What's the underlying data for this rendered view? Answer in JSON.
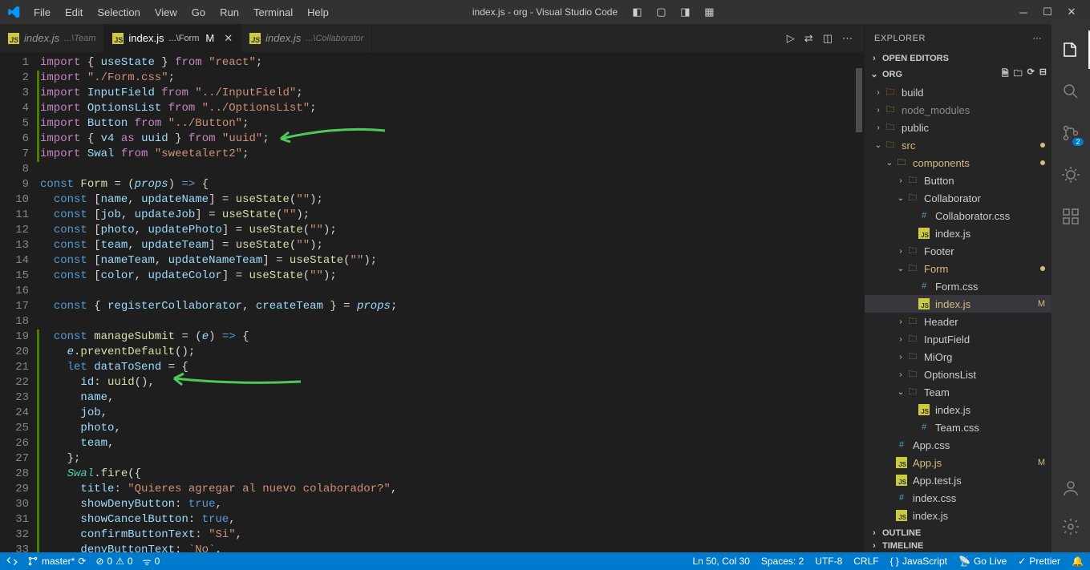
{
  "title": "index.js - org - Visual Studio Code",
  "menus": [
    "File",
    "Edit",
    "Selection",
    "View",
    "Go",
    "Run",
    "Terminal",
    "Help"
  ],
  "tabs": [
    {
      "name": "index.js",
      "path": "...\\Team",
      "active": false,
      "mod": false,
      "italic": true
    },
    {
      "name": "index.js",
      "path": "...\\Form",
      "active": true,
      "mod": true,
      "italic": false
    },
    {
      "name": "index.js",
      "path": "...\\Collaborator",
      "active": false,
      "mod": false,
      "italic": true
    }
  ],
  "sidebar": {
    "title": "EXPLORER",
    "openEditors": "OPEN EDITORS",
    "root": "ORG",
    "outline": "OUTLINE",
    "timeline": "TIMELINE"
  },
  "tree": [
    {
      "depth": 0,
      "type": "folder",
      "name": "build",
      "open": false,
      "color": "#e37933"
    },
    {
      "depth": 0,
      "type": "folder",
      "name": "node_modules",
      "open": false,
      "color": "#8dc149",
      "dim": true
    },
    {
      "depth": 0,
      "type": "folder",
      "name": "public",
      "open": false,
      "color": "#c09553"
    },
    {
      "depth": 0,
      "type": "folder",
      "name": "src",
      "open": true,
      "color": "#7fba00",
      "dot": true,
      "mod": true
    },
    {
      "depth": 1,
      "type": "folder",
      "name": "components",
      "open": true,
      "color": "#dcb67a",
      "dot": true,
      "mod": true
    },
    {
      "depth": 2,
      "type": "folder",
      "name": "Button",
      "open": false
    },
    {
      "depth": 2,
      "type": "folder",
      "name": "Collaborator",
      "open": true
    },
    {
      "depth": 3,
      "type": "css",
      "name": "Collaborator.css"
    },
    {
      "depth": 3,
      "type": "js",
      "name": "index.js"
    },
    {
      "depth": 2,
      "type": "folder",
      "name": "Footer",
      "open": false
    },
    {
      "depth": 2,
      "type": "folder",
      "name": "Form",
      "open": true,
      "dot": true,
      "mod": true
    },
    {
      "depth": 3,
      "type": "css",
      "name": "Form.css"
    },
    {
      "depth": 3,
      "type": "js",
      "name": "index.js",
      "selected": true,
      "badge": "M",
      "mod": true
    },
    {
      "depth": 2,
      "type": "folder",
      "name": "Header",
      "open": false
    },
    {
      "depth": 2,
      "type": "folder",
      "name": "InputField",
      "open": false
    },
    {
      "depth": 2,
      "type": "folder",
      "name": "MiOrg",
      "open": false
    },
    {
      "depth": 2,
      "type": "folder",
      "name": "OptionsList",
      "open": false
    },
    {
      "depth": 2,
      "type": "folder",
      "name": "Team",
      "open": true
    },
    {
      "depth": 3,
      "type": "js",
      "name": "index.js"
    },
    {
      "depth": 3,
      "type": "css",
      "name": "Team.css"
    },
    {
      "depth": 1,
      "type": "css",
      "name": "App.css"
    },
    {
      "depth": 1,
      "type": "js",
      "name": "App.js",
      "badge": "M",
      "mod": true
    },
    {
      "depth": 1,
      "type": "js",
      "name": "App.test.js"
    },
    {
      "depth": 1,
      "type": "css",
      "name": "index.css"
    },
    {
      "depth": 1,
      "type": "js",
      "name": "index.js"
    }
  ],
  "status": {
    "remote": "",
    "branch": "master*",
    "sync": "⟳",
    "errors": "0",
    "warnings": "0",
    "port": "0",
    "lncol": "Ln 50, Col 30",
    "spaces": "Spaces: 2",
    "encoding": "UTF-8",
    "eol": "CRLF",
    "lang": "JavaScript",
    "golive": "Go Live",
    "prettier": "Prettier"
  },
  "scm_badge": "2",
  "code": [
    {
      "n": 1,
      "html": "<span class='tk-k'>import</span> <span class='tk-pu'>{</span> <span class='tk-v'>useState</span> <span class='tk-pu'>}</span> <span class='tk-k'>from</span> <span class='tk-s'>\"react\"</span><span class='tk-pu'>;</span>"
    },
    {
      "n": 2,
      "html": "<span class='tk-k'>import</span> <span class='tk-s'>\"./Form.css\"</span><span class='tk-pu'>;</span>"
    },
    {
      "n": 3,
      "html": "<span class='tk-k'>import</span> <span class='tk-v'>InputField</span> <span class='tk-k'>from</span> <span class='tk-s'>\"../InputField\"</span><span class='tk-pu'>;</span>"
    },
    {
      "n": 4,
      "html": "<span class='tk-k'>import</span> <span class='tk-v'>OptionsList</span> <span class='tk-k'>from</span> <span class='tk-s'>\"../OptionsList\"</span><span class='tk-pu'>;</span>"
    },
    {
      "n": 5,
      "html": "<span class='tk-k'>import</span> <span class='tk-v'>Button</span> <span class='tk-k'>from</span> <span class='tk-s'>\"../Button\"</span><span class='tk-pu'>;</span>"
    },
    {
      "n": 6,
      "html": "<span class='tk-k'>import</span> <span class='tk-pu'>{</span> <span class='tk-v'>v4</span> <span class='tk-k'>as</span> <span class='tk-v'>uuid</span> <span class='tk-pu'>}</span> <span class='tk-k'>from</span> <span class='tk-s'>\"uuid\"</span><span class='tk-pu'>;</span>"
    },
    {
      "n": 7,
      "html": "<span class='tk-k'>import</span> <span class='tk-v'>Swal</span> <span class='tk-k'>from</span> <span class='tk-s'>\"sweetalert2\"</span><span class='tk-pu'>;</span>"
    },
    {
      "n": 8,
      "html": ""
    },
    {
      "n": 9,
      "html": "<span class='tk-p'>const</span> <span class='tk-fn'>Form</span> <span class='tk-pu'>=</span> <span class='tk-pu'>(</span><span class='tk-v tk-it'>props</span><span class='tk-pu'>)</span> <span class='tk-p'>=&gt;</span> <span class='tk-pu'>{</span>"
    },
    {
      "n": 10,
      "html": "  <span class='tk-p'>const</span> <span class='tk-pu'>[</span><span class='tk-v'>name</span><span class='tk-pu'>,</span> <span class='tk-v'>updateName</span><span class='tk-pu'>]</span> <span class='tk-pu'>=</span> <span class='tk-fn'>useState</span><span class='tk-pu'>(</span><span class='tk-s'>\"\"</span><span class='tk-pu'>);</span>"
    },
    {
      "n": 11,
      "html": "  <span class='tk-p'>const</span> <span class='tk-pu'>[</span><span class='tk-v'>job</span><span class='tk-pu'>,</span> <span class='tk-v'>updateJob</span><span class='tk-pu'>]</span> <span class='tk-pu'>=</span> <span class='tk-fn'>useState</span><span class='tk-pu'>(</span><span class='tk-s'>\"\"</span><span class='tk-pu'>);</span>"
    },
    {
      "n": 12,
      "html": "  <span class='tk-p'>const</span> <span class='tk-pu'>[</span><span class='tk-v'>photo</span><span class='tk-pu'>,</span> <span class='tk-v'>updatePhoto</span><span class='tk-pu'>]</span> <span class='tk-pu'>=</span> <span class='tk-fn'>useState</span><span class='tk-pu'>(</span><span class='tk-s'>\"\"</span><span class='tk-pu'>);</span>"
    },
    {
      "n": 13,
      "html": "  <span class='tk-p'>const</span> <span class='tk-pu'>[</span><span class='tk-v'>team</span><span class='tk-pu'>,</span> <span class='tk-v'>updateTeam</span><span class='tk-pu'>]</span> <span class='tk-pu'>=</span> <span class='tk-fn'>useState</span><span class='tk-pu'>(</span><span class='tk-s'>\"\"</span><span class='tk-pu'>);</span>"
    },
    {
      "n": 14,
      "html": "  <span class='tk-p'>const</span> <span class='tk-pu'>[</span><span class='tk-v'>nameTeam</span><span class='tk-pu'>,</span> <span class='tk-v'>updateNameTeam</span><span class='tk-pu'>]</span> <span class='tk-pu'>=</span> <span class='tk-fn'>useState</span><span class='tk-pu'>(</span><span class='tk-s'>\"\"</span><span class='tk-pu'>);</span>"
    },
    {
      "n": 15,
      "html": "  <span class='tk-p'>const</span> <span class='tk-pu'>[</span><span class='tk-v'>color</span><span class='tk-pu'>,</span> <span class='tk-v'>updateColor</span><span class='tk-pu'>]</span> <span class='tk-pu'>=</span> <span class='tk-fn'>useState</span><span class='tk-pu'>(</span><span class='tk-s'>\"\"</span><span class='tk-pu'>);</span>"
    },
    {
      "n": 16,
      "html": ""
    },
    {
      "n": 17,
      "html": "  <span class='tk-p'>const</span> <span class='tk-pu'>{</span> <span class='tk-v'>registerCollaborator</span><span class='tk-pu'>,</span> <span class='tk-v'>createTeam</span> <span class='tk-pu'>}</span> <span class='tk-pu'>=</span> <span class='tk-v tk-it'>props</span><span class='tk-pu'>;</span>"
    },
    {
      "n": 18,
      "html": ""
    },
    {
      "n": 19,
      "html": "  <span class='tk-p'>const</span> <span class='tk-fn'>manageSubmit</span> <span class='tk-pu'>=</span> <span class='tk-pu'>(</span><span class='tk-v tk-it'>e</span><span class='tk-pu'>)</span> <span class='tk-p'>=&gt;</span> <span class='tk-pu'>{</span>"
    },
    {
      "n": 20,
      "html": "    <span class='tk-v tk-it'>e</span><span class='tk-pu'>.</span><span class='tk-fn'>preventDefault</span><span class='tk-pu'>();</span>"
    },
    {
      "n": 21,
      "html": "    <span class='tk-p'>let</span> <span class='tk-v'>dataToSend</span> <span class='tk-pu'>=</span> <span class='tk-pu'>{</span>"
    },
    {
      "n": 22,
      "html": "      <span class='tk-v'>id</span><span class='tk-pu'>:</span> <span class='tk-fn'>uuid</span><span class='tk-pu'>(),</span>"
    },
    {
      "n": 23,
      "html": "      <span class='tk-v'>name</span><span class='tk-pu'>,</span>"
    },
    {
      "n": 24,
      "html": "      <span class='tk-v'>job</span><span class='tk-pu'>,</span>"
    },
    {
      "n": 25,
      "html": "      <span class='tk-v'>photo</span><span class='tk-pu'>,</span>"
    },
    {
      "n": 26,
      "html": "      <span class='tk-v'>team</span><span class='tk-pu'>,</span>"
    },
    {
      "n": 27,
      "html": "    <span class='tk-pu'>};</span>"
    },
    {
      "n": 28,
      "html": "    <span class='tk-ty tk-it'>Swal</span><span class='tk-pu'>.</span><span class='tk-fn'>fire</span><span class='tk-pu'>({</span>"
    },
    {
      "n": 29,
      "html": "      <span class='tk-v'>title</span><span class='tk-pu'>:</span> <span class='tk-s'>\"Quieres agregar al nuevo colaborador?\"</span><span class='tk-pu'>,</span>"
    },
    {
      "n": 30,
      "html": "      <span class='tk-v'>showDenyButton</span><span class='tk-pu'>:</span> <span class='tk-p'>true</span><span class='tk-pu'>,</span>"
    },
    {
      "n": 31,
      "html": "      <span class='tk-v'>showCancelButton</span><span class='tk-pu'>:</span> <span class='tk-p'>true</span><span class='tk-pu'>,</span>"
    },
    {
      "n": 32,
      "html": "      <span class='tk-v'>confirmButtonText</span><span class='tk-pu'>:</span> <span class='tk-s'>\"Si\"</span><span class='tk-pu'>,</span>"
    },
    {
      "n": 33,
      "html": "      <span class='tk-v'>denyButtonText</span><span class='tk-pu'>:</span> <span class='tk-s'>`No`</span><span class='tk-pu'>,</span>"
    }
  ]
}
